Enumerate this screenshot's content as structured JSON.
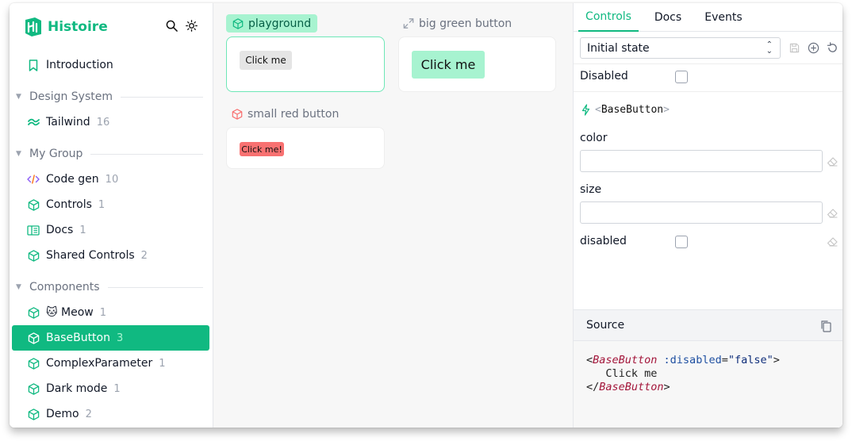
{
  "app": {
    "name": "Histoire"
  },
  "colors": {
    "accent": "#10b981",
    "green_button": "#a7f3d0",
    "red_button": "#f87171"
  },
  "sidebar": {
    "top_icons": [
      "search-icon",
      "sun-icon"
    ],
    "introduction": {
      "label": "Introduction",
      "icon": "bookmark-icon"
    },
    "groups": [
      {
        "label": "Design System"
      },
      {
        "label": "My Group"
      },
      {
        "label": "Components"
      }
    ],
    "items": [
      {
        "label": "Tailwind",
        "count": "16",
        "icon": "tailwind-icon"
      },
      {
        "label": "Code gen",
        "count": "10",
        "icon": "code-icon"
      },
      {
        "label": "Controls",
        "count": "1",
        "icon": "cube-icon"
      },
      {
        "label": "Docs",
        "count": "1",
        "icon": "book-icon"
      },
      {
        "label": "Shared Controls",
        "count": "2",
        "icon": "cube-icon"
      },
      {
        "label": "🐱 Meow",
        "count": "1",
        "icon": "cube-icon"
      },
      {
        "label": "BaseButton",
        "count": "3",
        "icon": "cube-icon",
        "active": true
      },
      {
        "label": "ComplexParameter",
        "count": "1",
        "icon": "cube-icon"
      },
      {
        "label": "Dark mode",
        "count": "1",
        "icon": "cube-icon"
      },
      {
        "label": "Demo",
        "count": "2",
        "icon": "cube-icon"
      }
    ]
  },
  "variants": [
    {
      "label": "playground",
      "button": "Click me",
      "icon": "cube-icon"
    },
    {
      "label": "big green button",
      "button": "Click me",
      "icon": "expand-icon"
    },
    {
      "label": "small red button",
      "button": "Click me!",
      "icon": "cube-icon"
    }
  ],
  "panel": {
    "tabs": [
      "Controls",
      "Docs",
      "Events"
    ],
    "active_tab": "Controls",
    "state_select": {
      "value": "Initial state"
    },
    "state_icons": [
      "save-icon",
      "add-circle-icon",
      "reset-icon"
    ],
    "disabled_label": "Disabled",
    "component": {
      "open": "<",
      "name": "BaseButton",
      "close": ">"
    },
    "props": [
      {
        "label": "color",
        "type": "text",
        "value": ""
      },
      {
        "label": "size",
        "type": "text",
        "value": ""
      },
      {
        "label": "disabled",
        "type": "checkbox",
        "value": false
      }
    ],
    "source": {
      "title": "Source",
      "line1_open": "<",
      "line1_tag": "BaseButton",
      "line1_attr": " :disabled",
      "line1_eq": "=",
      "line1_str": "\"false\"",
      "line1_close": ">",
      "line2": "   Click me",
      "line3_open": "</",
      "line3_tag": "BaseButton",
      "line3_close": ">"
    }
  }
}
